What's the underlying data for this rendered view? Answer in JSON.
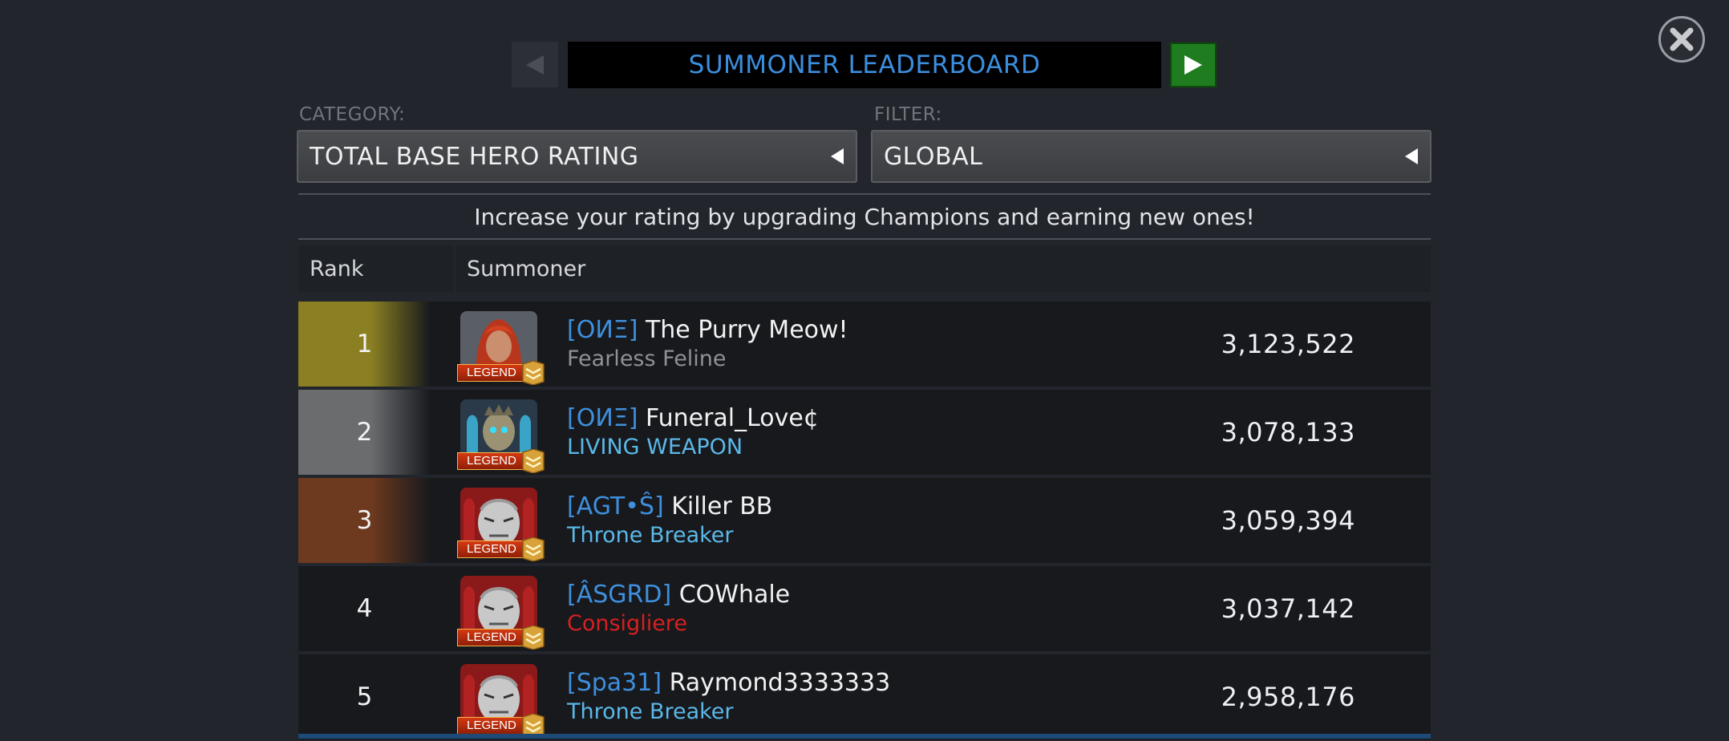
{
  "title": "SUMMONER LEADERBOARD",
  "category": {
    "label": "CATEGORY:",
    "value": "TOTAL BASE HERO RATING"
  },
  "filter": {
    "label": "FILTER:",
    "value": "GLOBAL"
  },
  "info": "Increase your rating by upgrading Champions and earning new ones!",
  "columns": {
    "rank": "Rank",
    "summoner": "Summoner"
  },
  "badge_text": "LEGEND",
  "colors": {
    "accent_blue": "#3b8ede",
    "rank1": "#8a7f22",
    "rank2": "#6b6c6e",
    "rank3": "#6e3a1f",
    "title_light_blue": "#5bb8e8",
    "title_red": "#d62020",
    "title_gray": "#8e9196",
    "next_button_green": "#1f7d1f"
  },
  "rows": [
    {
      "rank": "1",
      "tag": "[OИΞ]",
      "name": "The Purry Meow!",
      "title": "Fearless Feline",
      "rating": "3,123,522",
      "avatar": "red-haired-champion-icon"
    },
    {
      "rank": "2",
      "tag": "[OИΞ]",
      "name": "Funeral_Love¢",
      "title": "LIVING WEAPON",
      "rating": "3,078,133",
      "avatar": "undead-champion-icon"
    },
    {
      "rank": "3",
      "tag": "[AGT•Ŝ]",
      "name": "Killer BB",
      "title": "Throne Breaker",
      "rating": "3,059,394",
      "avatar": "silver-brute-champion-icon"
    },
    {
      "rank": "4",
      "tag": "[ÂSGRD]",
      "name": "COWhale",
      "title": "Consigliere",
      "rating": "3,037,142",
      "avatar": "silver-brute-champion-icon"
    },
    {
      "rank": "5",
      "tag": "[Spa31]",
      "name": "Raymond3333333",
      "title": "Throne Breaker",
      "rating": "2,958,176",
      "avatar": "silver-brute-champion-icon"
    }
  ]
}
